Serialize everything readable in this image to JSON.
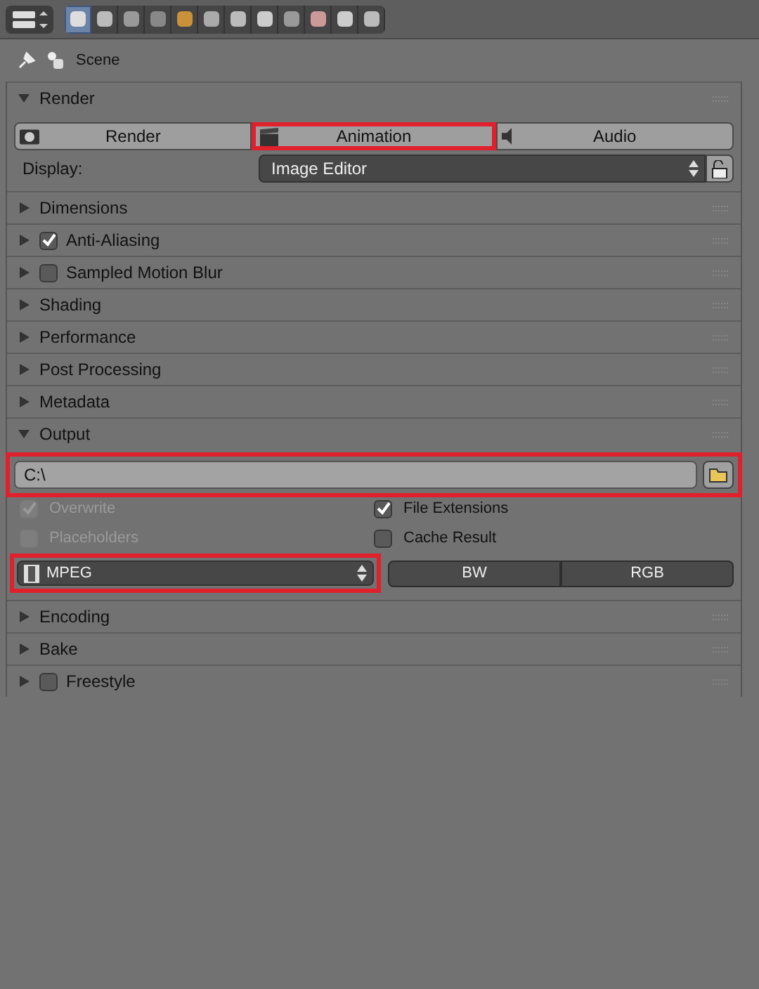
{
  "context_tabs": [
    {
      "selected": true
    },
    {
      "selected": false
    },
    {
      "selected": false
    },
    {
      "selected": false
    },
    {
      "selected": false
    },
    {
      "selected": false
    },
    {
      "selected": false
    },
    {
      "selected": false
    },
    {
      "selected": false
    },
    {
      "selected": false
    },
    {
      "selected": false
    },
    {
      "selected": false
    }
  ],
  "breadcrumb": "Scene",
  "sections": [
    {
      "title": "Render",
      "expanded": true,
      "kind": "render"
    },
    {
      "title": "Dimensions",
      "expanded": false
    },
    {
      "title": "Anti-Aliasing",
      "expanded": false,
      "checked": true
    },
    {
      "title": "Sampled Motion Blur",
      "expanded": false,
      "checked": false
    },
    {
      "title": "Shading",
      "expanded": false
    },
    {
      "title": "Performance",
      "expanded": false
    },
    {
      "title": "Post Processing",
      "expanded": false
    },
    {
      "title": "Metadata",
      "expanded": false
    },
    {
      "title": "Output",
      "expanded": true,
      "kind": "output"
    },
    {
      "title": "Encoding",
      "expanded": false
    },
    {
      "title": "Bake",
      "expanded": false
    },
    {
      "title": "Freestyle",
      "expanded": false,
      "checked": false
    }
  ],
  "render": {
    "buttons": [
      {
        "label": "Render",
        "highlighted": false
      },
      {
        "label": "Animation",
        "highlighted": true
      },
      {
        "label": "Audio",
        "highlighted": false
      }
    ],
    "display_label": "Display:",
    "display_value": "Image Editor"
  },
  "output": {
    "path": "C:\\",
    "path_highlighted": true,
    "options": [
      {
        "label": "Overwrite",
        "checked": true,
        "disabled": true
      },
      {
        "label": "File Extensions",
        "checked": true,
        "disabled": false
      },
      {
        "label": "Placeholders",
        "checked": false,
        "disabled": true
      },
      {
        "label": "Cache Result",
        "checked": false,
        "disabled": false
      }
    ],
    "format": "MPEG",
    "format_highlighted": true,
    "color_modes": [
      "BW",
      "RGB"
    ]
  }
}
